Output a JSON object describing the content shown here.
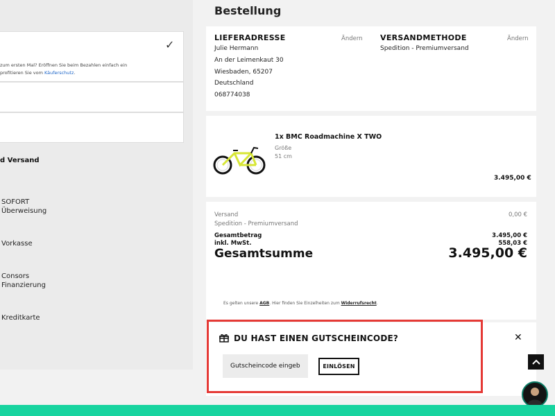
{
  "payment": {
    "paypal_info_line1": "zum ersten Mal? Eröffnen Sie beim Bezahlen einfach ein",
    "paypal_info_line2_prefix": "profitieren Sie vom ",
    "paypal_info_link": "Käuferschutz",
    "paypal_info_line2_suffix": ".",
    "shipping_heading": "d Versand",
    "options": [
      {
        "label": "SOFORT\nÜberweisung"
      },
      {
        "label": "Vorkasse"
      },
      {
        "label": "Consors\nFinanzierung"
      },
      {
        "label": "Kreditkarte"
      }
    ]
  },
  "order": {
    "title": "Bestellung",
    "address": {
      "heading": "LIEFERADRESSE",
      "edit": "Ändern",
      "lines": [
        "Julie Hermann",
        "An der Leimenkaut 30",
        "Wiesbaden, 65207",
        "Deutschland",
        "068774038"
      ]
    },
    "shipping": {
      "heading": "VERSANDMETHODE",
      "edit": "Ändern",
      "method": "Spedition - Premiumversand"
    },
    "item": {
      "title": "1x  BMC Roadmachine X TWO",
      "size_label": "Größe",
      "size_value": "51 cm",
      "price": "3.495,00 €"
    },
    "summary": {
      "versand_label": "Versand",
      "versand_method": "Spedition - Premiumversand",
      "versand_value": "0,00 €",
      "gesamtbetrag_label": "Gesamtbetrag",
      "gesamtbetrag_value": "3.495,00 €",
      "mwst_label": "inkl. MwSt.",
      "mwst_value": "558,03 €",
      "gesamtsumme_label": "Gesamtsumme",
      "gesamtsumme_value": "3.495,00 €"
    },
    "legal": {
      "prefix": "Es gelten unsere ",
      "agb": "AGB",
      "middle": ". Hier finden Sie Einzelheiten zum ",
      "widerruf": "Widerrufsrecht",
      "suffix": "."
    }
  },
  "voucher": {
    "title": "DU HAST EINEN GUTSCHEINCODE?",
    "input_value": "Gutscheincode eingeb",
    "redeem_label": "EINLÖSEN",
    "close_icon": "close-icon"
  },
  "colors": {
    "highlight": "#e53935",
    "footer": "#17d49f",
    "link": "#1a63c7"
  }
}
